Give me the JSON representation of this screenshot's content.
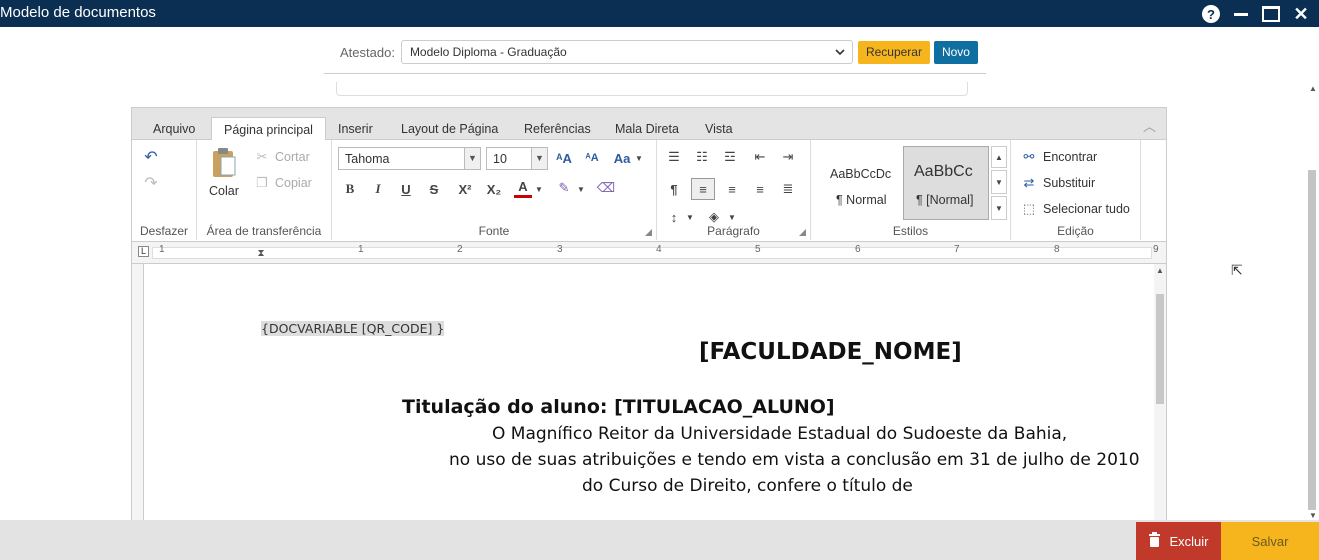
{
  "window": {
    "title": "Modelo de documentos"
  },
  "toolbar": {
    "attest_label": "Atestado:",
    "attest_value": "Modelo Diploma - Graduação",
    "recover_label": "Recuperar",
    "new_label": "Novo"
  },
  "tabs": [
    "Arquivo",
    "Página principal",
    "Inserir",
    "Layout de Página",
    "Referências",
    "Mala Direta",
    "Vista"
  ],
  "ribbon": {
    "undo_group": "Desfazer",
    "clipboard_group": "Área de transferência",
    "paste_label": "Colar",
    "cut_label": "Cortar",
    "copy_label": "Copiar",
    "font_group": "Fonte",
    "font_name": "Tahoma",
    "font_size": "10",
    "paragraph_group": "Parágrafo",
    "styles_group": "Estilos",
    "style1_preview": "AaBbCcDc",
    "style1_name": "¶ Normal",
    "style2_preview": "AaBbCc",
    "style2_name": "¶ [Normal]",
    "edit_group": "Edição",
    "find_label": "Encontrar",
    "replace_label": "Substituir",
    "select_all_label": "Selecionar tudo"
  },
  "ruler": {
    "numbers": [
      "1",
      "1",
      "2",
      "3",
      "4",
      "5",
      "6",
      "7",
      "8",
      "9"
    ]
  },
  "document": {
    "qr_field": "{DOCVARIABLE [QR_CODE] }",
    "faculty": "[FACULDADE_NOME]",
    "title_line": "Titulação do aluno:  [TITULACAO_ALUNO]",
    "line1": "O Magnífico Reitor da Universidade Estadual do Sudoeste da Bahia,",
    "line2": "no uso de suas atribuições e tendo em vista a conclusão em  31 de julho de 2010",
    "line3": "do Curso de Direito, confere o título de"
  },
  "actions": {
    "delete_label": "Excluir",
    "save_label": "Salvar"
  },
  "colors": {
    "titlebar": "#0b2f52",
    "recover": "#f6b51c",
    "new": "#0f6fa0",
    "delete": "#c0392b",
    "save": "#f6b51c"
  }
}
